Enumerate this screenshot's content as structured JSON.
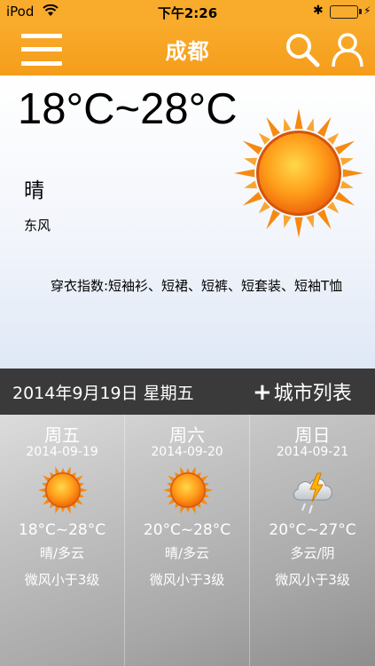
{
  "status_bar": {
    "carrier": "iPod",
    "time": "下午2:26",
    "battery_level": 1.0
  },
  "nav": {
    "title": "成都",
    "menu_icon": "menu-icon",
    "search_icon": "search-icon",
    "user_icon": "user-icon"
  },
  "current": {
    "temp_range": "18°C~28°C",
    "condition": "晴",
    "wind": "东风",
    "dress_index": "穿衣指数:短袖衫、短裙、短裤、短套装、短袖T恤",
    "icon": "sun-icon"
  },
  "date_bar": {
    "date": "2014年9月19日 星期五",
    "city_list_label": "城市列表"
  },
  "forecast": [
    {
      "day": "周五",
      "date": "2014-09-19",
      "temp": "18°C~28°C",
      "condition": "晴/多云",
      "wind": "微风小于3级",
      "icon": "sun-icon"
    },
    {
      "day": "周六",
      "date": "2014-09-20",
      "temp": "20°C~28°C",
      "condition": "晴/多云",
      "wind": "微风小于3级",
      "icon": "sun-icon"
    },
    {
      "day": "周日",
      "date": "2014-09-21",
      "temp": "20°C~27°C",
      "condition": "多云/阴",
      "wind": "微风小于3级",
      "icon": "thunderstorm-icon"
    }
  ],
  "colors": {
    "accent": "#f9ab2b",
    "date_bar": "#3a3a3a"
  }
}
